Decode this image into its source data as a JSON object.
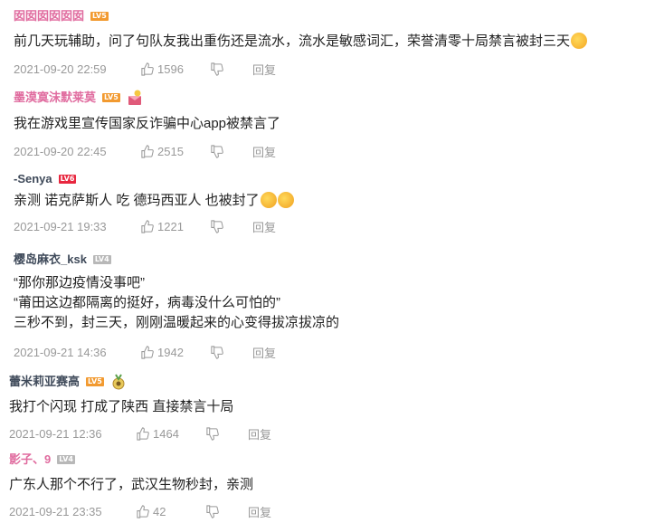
{
  "colors": {
    "username_pink": "#e06c9f",
    "username_dark": "#3f4a5a",
    "lv5": "#f29a30",
    "lv6": "#e8273f",
    "lv_gray": "#b8b8b8",
    "meta_gray": "#999999",
    "text": "#222222"
  },
  "comments": [
    {
      "username": "囡囡囡囡囡囡",
      "level": "LV5",
      "lines": [
        "前几天玩辅助，问了句队友我出重伤还是流水，流水是敏感词汇，荣誉清零十局禁言被封三天"
      ],
      "time": "2021-09-20 22:59",
      "likes": "1596",
      "reply": "回复"
    },
    {
      "username": "墨漠寞沫默莱莫",
      "level": "LV5",
      "lines": [
        "我在游戏里宣传国家反诈骗中心app被禁言了"
      ],
      "time": "2021-09-20 22:45",
      "likes": "2515",
      "reply": "回复"
    },
    {
      "username": "-Senya",
      "level": "LV6",
      "lines": [
        "亲测 诺克萨斯人 吃 德玛西亚人 也被封了"
      ],
      "time": "2021-09-21 19:33",
      "likes": "1221",
      "reply": "回复"
    },
    {
      "username": "樱岛麻衣_ksk",
      "level": "LV4",
      "lines": [
        "“那你那边疫情没事吧”",
        "“莆田这边都隔离的挺好，病毒没什么可怕的”",
        "三秒不到，封三天，刚刚温暖起来的心变得拔凉拔凉的"
      ],
      "time": "2021-09-21 14:36",
      "likes": "1942",
      "reply": "回复"
    },
    {
      "username": "蕾米莉亚赛高",
      "level": "LV5",
      "lines": [
        "我打个闪现 打成了陕西 直接禁言十局"
      ],
      "time": "2021-09-21 12:36",
      "likes": "1464",
      "reply": "回复"
    },
    {
      "username": "影子、9",
      "level": "LV4",
      "lines": [
        "广东人那个不行了，武汉生物秒封，亲测"
      ],
      "time": "2021-09-21 23:35",
      "likes": "42",
      "reply": "回复"
    }
  ]
}
